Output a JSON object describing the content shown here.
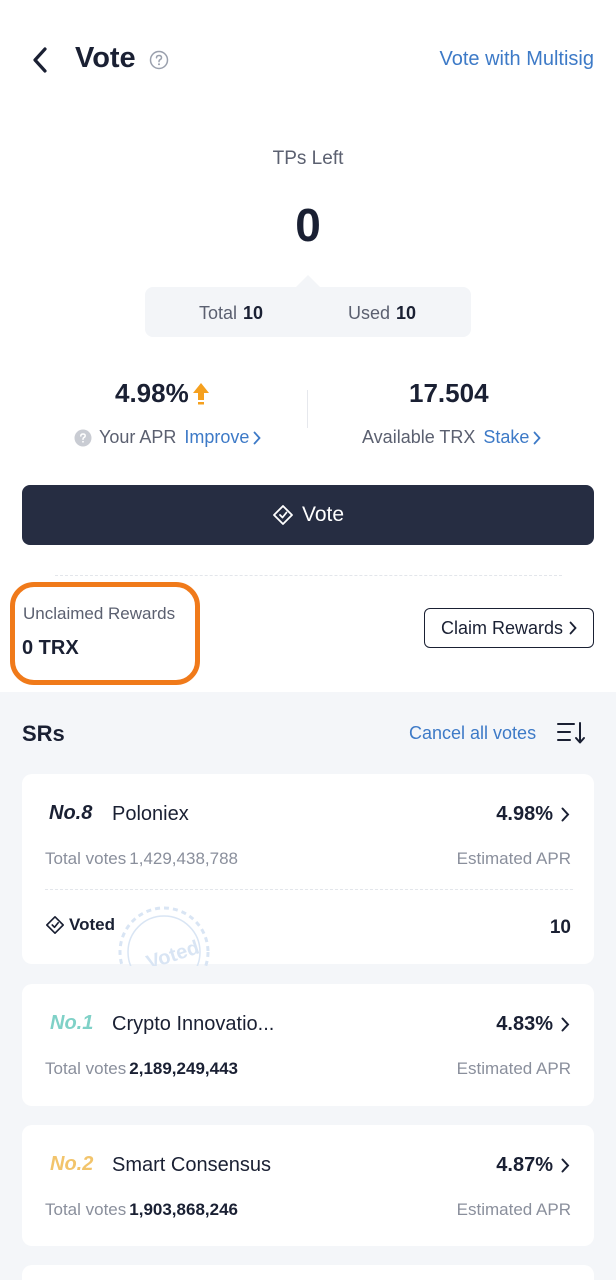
{
  "header": {
    "title": "Vote",
    "multisig_link": "Vote with Multisig"
  },
  "tp": {
    "label": "TPs Left",
    "left_value": "0",
    "total_label": "Total",
    "total_value": "10",
    "used_label": "Used",
    "used_value": "10"
  },
  "stats": {
    "apr_value": "4.98%",
    "apr_label": "Your APR",
    "apr_link": "Improve",
    "trx_value": "17.504",
    "trx_label": "Available TRX",
    "trx_link": "Stake"
  },
  "vote_button": "Vote",
  "rewards": {
    "label": "Unclaimed Rewards",
    "value": "0 TRX",
    "claim_button": "Claim Rewards"
  },
  "srs": {
    "title": "SRs",
    "cancel_all": "Cancel all votes",
    "items": [
      {
        "rank": "No.8",
        "name": "Poloniex",
        "apr": "4.98%",
        "votes_label": "Total votes",
        "votes": "1,429,438,788",
        "apr_label": "Estimated APR",
        "voted_label": "Voted",
        "voted_count": "10",
        "stamp_text": "Voted"
      },
      {
        "rank": "No.1",
        "name": "Crypto Innovatio...",
        "apr": "4.83%",
        "votes_label": "Total votes",
        "votes": "2,189,249,443",
        "apr_label": "Estimated APR"
      },
      {
        "rank": "No.2",
        "name": "Smart Consensus",
        "apr": "4.87%",
        "votes_label": "Total votes",
        "votes": "1,903,868,246",
        "apr_label": "Estimated APR"
      }
    ]
  },
  "colors": {
    "accent_link": "#3d7ac7",
    "vote_button_bg": "#262d42",
    "highlight_orange": "#f07a1a",
    "rank_1_teal": "#7fd1c7",
    "rank_2_gold": "#f2c46b",
    "apr_up_arrow": "#f5a01e"
  }
}
